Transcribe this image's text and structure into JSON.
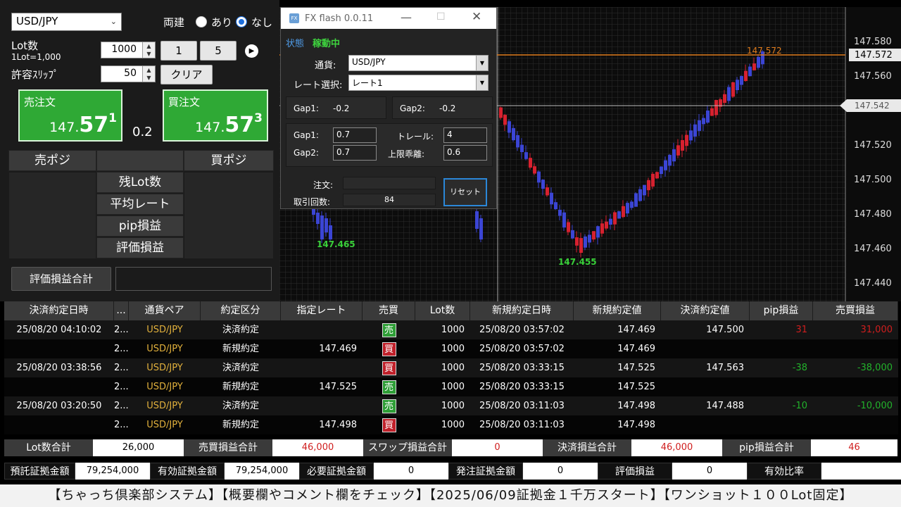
{
  "left": {
    "currency": "USD/JPY",
    "hedge_label": "両建",
    "radio_yes": "あり",
    "radio_no": "なし",
    "lot_label": "Lot数",
    "lot_unit": "1Lot=1,000",
    "lot_value": "1000",
    "slip_label": "許容ｽﾘｯﾌﾟ",
    "slip_value": "50",
    "btn_1": "1",
    "btn_5": "5",
    "clear_label": "クリア",
    "sell_label": "売注文",
    "sell_price_a": "147.",
    "sell_price_b": "57",
    "sell_price_c": "1",
    "spread": "0.2",
    "buy_label": "買注文",
    "buy_price_a": "147.",
    "buy_price_b": "57",
    "buy_price_c": "3",
    "sell_pos": "売ポジ",
    "buy_pos": "買ポジ",
    "rows": [
      "残Lot数",
      "平均レート",
      "pip損益",
      "評価損益"
    ],
    "total_label": "評価損益合計"
  },
  "chart": {
    "y_ticks": [
      "147.580",
      "147.560",
      "147.540",
      "147.520",
      "147.500",
      "147.480",
      "147.460",
      "147.440"
    ],
    "current_price": "147.572",
    "line_price": "147.542",
    "high_label": "147.572",
    "low_label": "147.455",
    "low_label2": "147.465",
    "colors": {
      "up": "#d6212f",
      "down": "#3b45d4",
      "price_line": "#e07b1b",
      "grid": "#3a3a3a"
    }
  },
  "fx": {
    "title": "FX flash 0.0.11",
    "status_label": "状態",
    "status_value": "稼動中",
    "currency_label": "通貨:",
    "currency_value": "USD/JPY",
    "rate_label": "レート選択:",
    "rate_value": "レート1",
    "gap1_label": "Gap1:",
    "gap1_value": "-0.2",
    "gap2_label": "Gap2:",
    "gap2_value": "-0.2",
    "gap1_in_label": "Gap1:",
    "gap1_in": "0.7",
    "gap2_in_label": "Gap2:",
    "gap2_in": "0.7",
    "trail_label": "トレール:",
    "trail_value": "4",
    "limit_label": "上限乖離:",
    "limit_value": "0.6",
    "order_label": "注文:",
    "order_value": "",
    "count_label": "取引回数:",
    "count_value": "84",
    "reset_label": "リセット"
  },
  "table": {
    "headers": [
      "決済約定日時",
      "...",
      "通貨ペア",
      "約定区分",
      "指定レート",
      "売買",
      "Lot数",
      "新規約定日時",
      "新規約定値",
      "決済約定値",
      "pip損益",
      "売買損益"
    ],
    "rows": [
      {
        "settle_time": "25/08/20 04:10:02",
        "id": "2...",
        "pair": "USD/JPY",
        "type": "決済約定",
        "rate": "",
        "side": "売",
        "lot": "1000",
        "open_time": "25/08/20 03:57:02",
        "open_price": "147.469",
        "close_price": "147.500",
        "pip": "31",
        "pl": "31,000"
      },
      {
        "settle_time": "",
        "id": "2...",
        "pair": "USD/JPY",
        "type": "新規約定",
        "rate": "147.469",
        "side": "買",
        "lot": "1000",
        "open_time": "25/08/20 03:57:02",
        "open_price": "147.469",
        "close_price": "",
        "pip": "",
        "pl": ""
      },
      {
        "settle_time": "25/08/20 03:38:56",
        "id": "2...",
        "pair": "USD/JPY",
        "type": "決済約定",
        "rate": "",
        "side": "買",
        "lot": "1000",
        "open_time": "25/08/20 03:33:15",
        "open_price": "147.525",
        "close_price": "147.563",
        "pip": "-38",
        "pl": "-38,000"
      },
      {
        "settle_time": "",
        "id": "2...",
        "pair": "USD/JPY",
        "type": "新規約定",
        "rate": "147.525",
        "side": "売",
        "lot": "1000",
        "open_time": "25/08/20 03:33:15",
        "open_price": "147.525",
        "close_price": "",
        "pip": "",
        "pl": ""
      },
      {
        "settle_time": "25/08/20 03:20:50",
        "id": "2...",
        "pair": "USD/JPY",
        "type": "決済約定",
        "rate": "",
        "side": "売",
        "lot": "1000",
        "open_time": "25/08/20 03:11:03",
        "open_price": "147.498",
        "close_price": "147.488",
        "pip": "-10",
        "pl": "-10,000"
      },
      {
        "settle_time": "",
        "id": "2...",
        "pair": "USD/JPY",
        "type": "新規約定",
        "rate": "147.498",
        "side": "買",
        "lot": "1000",
        "open_time": "25/08/20 03:11:03",
        "open_price": "147.498",
        "close_price": "",
        "pip": "",
        "pl": ""
      }
    ],
    "colors": {
      "sell": "#2e9e36",
      "buy": "#c0202a",
      "profit": "#d01e1e",
      "loss": "#22b22b",
      "pair": "#e2b13c"
    }
  },
  "summary1": [
    {
      "label": "Lot数合計",
      "value": "26,000"
    },
    {
      "label": "売買損益合計",
      "value": "46,000"
    },
    {
      "label": "スワップ損益合計",
      "value": "0"
    },
    {
      "label": "決済損益合計",
      "value": "46,000"
    },
    {
      "label": "pip損益合計",
      "value": "46"
    }
  ],
  "summary2": [
    {
      "label": "預託証拠金額",
      "value": "79,254,000"
    },
    {
      "label": "有効証拠金額",
      "value": "79,254,000"
    },
    {
      "label": "必要証拠金額",
      "value": "0"
    },
    {
      "label": "発注証拠金額",
      "value": "0"
    },
    {
      "label": "評価損益",
      "value": "0"
    },
    {
      "label": "有効比率",
      "value": ""
    }
  ],
  "banner": "【ちゃっち倶楽部システム】【概要欄やコメント欄をチェック】【2025/06/09証拠金１千万スタート】【ワンショット１００Lot固定】"
}
